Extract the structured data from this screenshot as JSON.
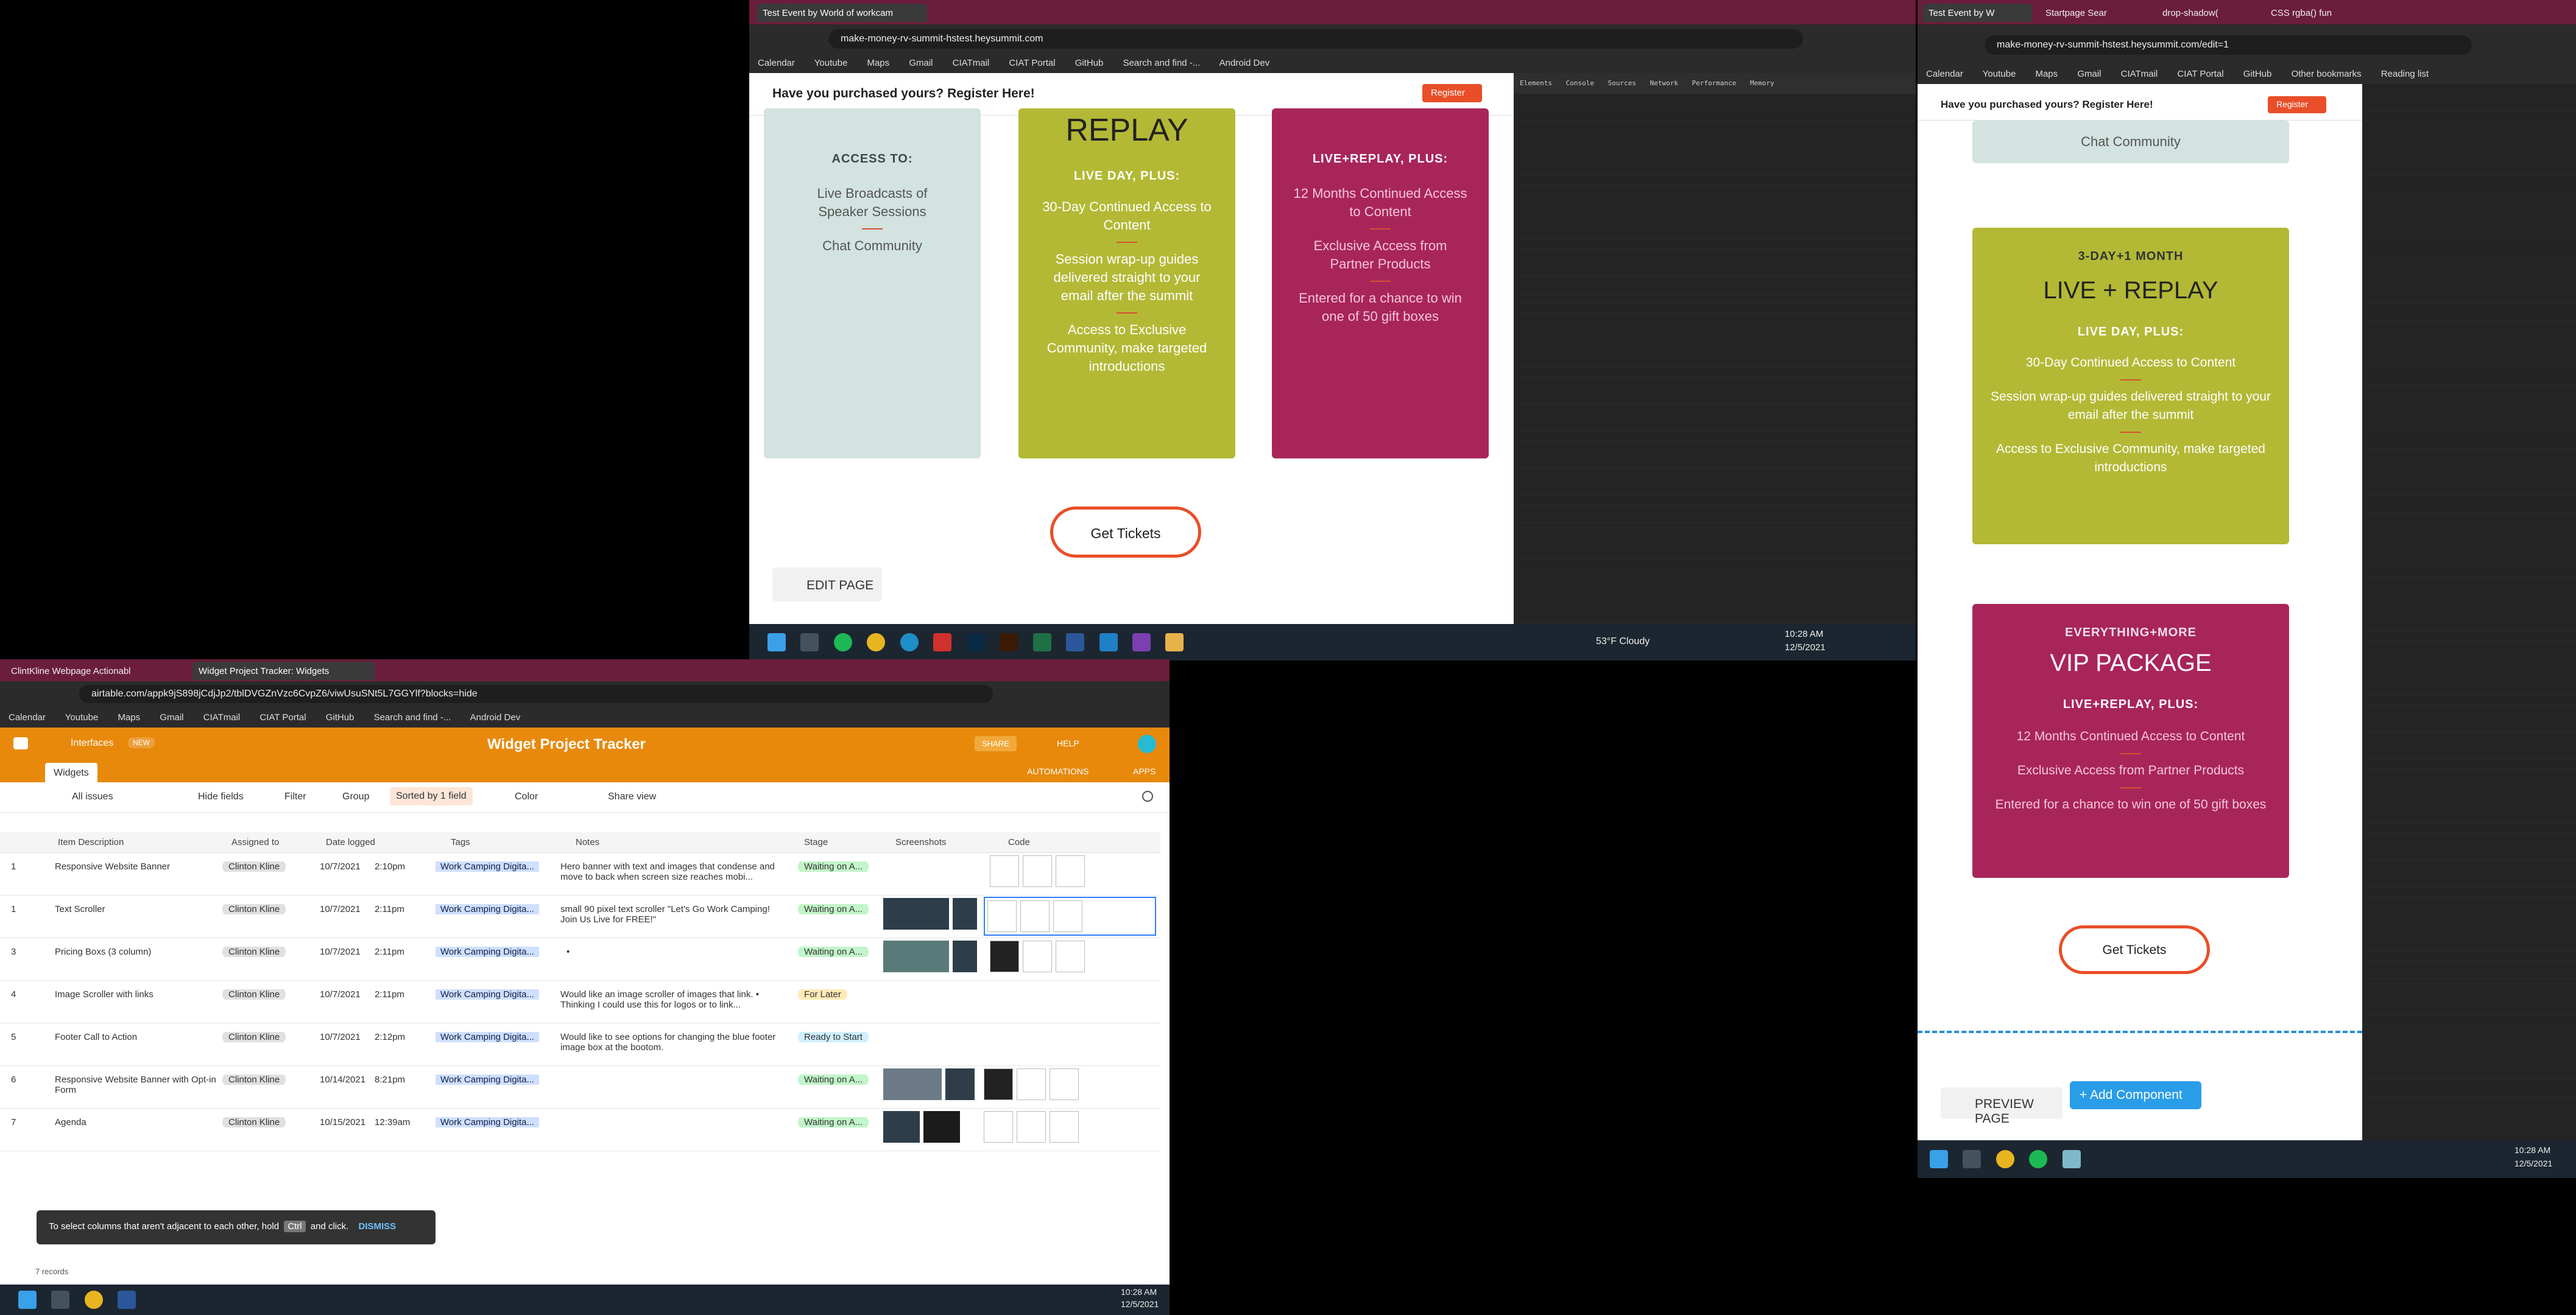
{
  "top_browser": {
    "tab_active": "Test Event by World of workcam",
    "url": "make-money-rv-summit-hstest.heysummit.com",
    "bookmarks": [
      "Calendar",
      "Youtube",
      "Maps",
      "Gmail",
      "CIATmail",
      "CIAT Portal",
      "GitHub",
      "Search and find -...",
      "Android Dev"
    ],
    "banner": "Have you purchased yours? Register Here!",
    "register": "Register",
    "card1": {
      "cap": "ACCESS TO:",
      "lines": [
        "Live Broadcasts of",
        "Speaker Sessions"
      ],
      "line2": "Chat Community"
    },
    "card2": {
      "title": "REPLAY",
      "cap": "LIVE DAY, PLUS:",
      "l1": "30-Day Continued Access to Content",
      "l2": "Session wrap-up guides delivered straight to your email after the summit",
      "l3": "Access to Exclusive Community, make targeted introductions"
    },
    "card3": {
      "cap": "LIVE+REPLAY, PLUS:",
      "l1": "12 Months Continued Access to Content",
      "l2": "Exclusive Access from Partner Products",
      "l3": "Entered for a chance to win one of 50 gift boxes"
    },
    "get_tickets": "Get Tickets",
    "edit_page": "EDIT PAGE",
    "devtools_tabs": [
      "Elements",
      "Console",
      "Sources",
      "Network",
      "Performance",
      "Memory"
    ],
    "weather": "53°F Cloudy",
    "time": "10:28 AM",
    "date": "12/5/2021"
  },
  "right_browser": {
    "tabs": [
      "Test Event by W",
      "Startpage Sear",
      "drop-shadow(",
      "CSS rgba() fun"
    ],
    "url": "make-money-rv-summit-hstest.heysummit.com/edit=1",
    "banner": "Have you purchased yours? Register Here!",
    "register": "Register",
    "other_bookmarks": "Other bookmarks",
    "reading_list": "Reading list",
    "chat": "Chat Community",
    "card_a": {
      "cap": "3-DAY+1 MONTH",
      "title": "LIVE + REPLAY",
      "sub": "LIVE DAY, PLUS:",
      "l1": "30-Day Continued Access to Content",
      "l2": "Session wrap-up guides delivered straight to your email after the summit",
      "l3": "Access to Exclusive Community, make targeted introductions"
    },
    "card_b": {
      "cap": "EVERYTHING+MORE",
      "title": "VIP PACKAGE",
      "sub": "LIVE+REPLAY, PLUS:",
      "l1": "12 Months Continued Access to Content",
      "l2": "Exclusive Access from Partner Products",
      "l3": "Entered for a chance to win one of 50 gift boxes"
    },
    "get_tickets": "Get Tickets",
    "preview": "PREVIEW PAGE",
    "add_component": "+ Add Component",
    "time": "10:28 AM",
    "date": "12/5/2021"
  },
  "airtable": {
    "tabs": [
      "ClintKline Webpage Actionabl",
      "Widget Project Tracker: Widgets"
    ],
    "url": "airtable.com/appk9jS898jCdjJp2/tblDVGZnVzc6CvpZ6/viwUsuSNt5L7GGYlf?blocks=hide",
    "interfaces": "Interfaces",
    "new_badge": "NEW",
    "base_title": "Widget Project Tracker",
    "share": "SHARE",
    "help": "HELP",
    "table_tab": "Widgets",
    "automations": "AUTOMATIONS",
    "apps": "APPS",
    "toolbar": {
      "view": "All issues",
      "hide": "Hide fields",
      "filter": "Filter",
      "group": "Group",
      "sort": "Sorted by 1 field",
      "color": "Color",
      "share": "Share view"
    },
    "columns": [
      "Item Description",
      "Assigned to",
      "Date logged",
      "Tags",
      "Notes",
      "Stage",
      "Screenshots",
      "Code"
    ],
    "rows": [
      {
        "n": "1",
        "desc": "Responsive Website Banner",
        "who": "Clinton Kline",
        "date": "10/7/2021",
        "time": "2:10pm",
        "tag": "Work Camping Digita...",
        "notes": "Hero banner with text and images that condense and move to back when screen size reaches mobi...",
        "stage": "Waiting on A..."
      },
      {
        "n": "1",
        "desc": "Text Scroller",
        "who": "Clinton Kline",
        "date": "10/7/2021",
        "time": "2:11pm",
        "tag": "Work Camping Digita...",
        "notes": "small 90 pixel text scroller \"Let's Go Work Camping! Join Us Live for FREE!\"",
        "stage": "Waiting on A..."
      },
      {
        "n": "3",
        "desc": "Pricing Boxs (3 column)",
        "who": "Clinton Kline",
        "date": "10/7/2021",
        "time": "2:11pm",
        "tag": "Work Camping Digita...",
        "notes": "•",
        "stage": "Waiting on A..."
      },
      {
        "n": "4",
        "desc": "Image Scroller with links",
        "who": "Clinton Kline",
        "date": "10/7/2021",
        "time": "2:11pm",
        "tag": "Work Camping Digita...",
        "notes": "Would like an image scroller of images that link. • Thinking I could use this for logos or to link...",
        "stage": "For Later"
      },
      {
        "n": "5",
        "desc": "Footer Call to Action",
        "who": "Clinton Kline",
        "date": "10/7/2021",
        "time": "2:12pm",
        "tag": "Work Camping Digita...",
        "notes": "Would like to see options for changing the blue footer image box at the bootom.",
        "stage": "Ready to Start"
      },
      {
        "n": "6",
        "desc": "Responsive Website Banner with Opt-in Form",
        "who": "Clinton Kline",
        "date": "10/14/2021",
        "time": "8:21pm",
        "tag": "Work Camping Digita...",
        "notes": "",
        "stage": "Waiting on A..."
      },
      {
        "n": "7",
        "desc": "Agenda",
        "who": "Clinton Kline",
        "date": "10/15/2021",
        "time": "12:39am",
        "tag": "Work Camping Digita...",
        "notes": "",
        "stage": "Waiting on A..."
      }
    ],
    "toast": "To select columns that aren't adjacent to each other, hold",
    "toast_key": "Ctrl",
    "toast_end": "and click.",
    "dismiss": "DISMISS",
    "records": "7 records",
    "time": "10:28 AM",
    "date": "12/5/2021"
  }
}
